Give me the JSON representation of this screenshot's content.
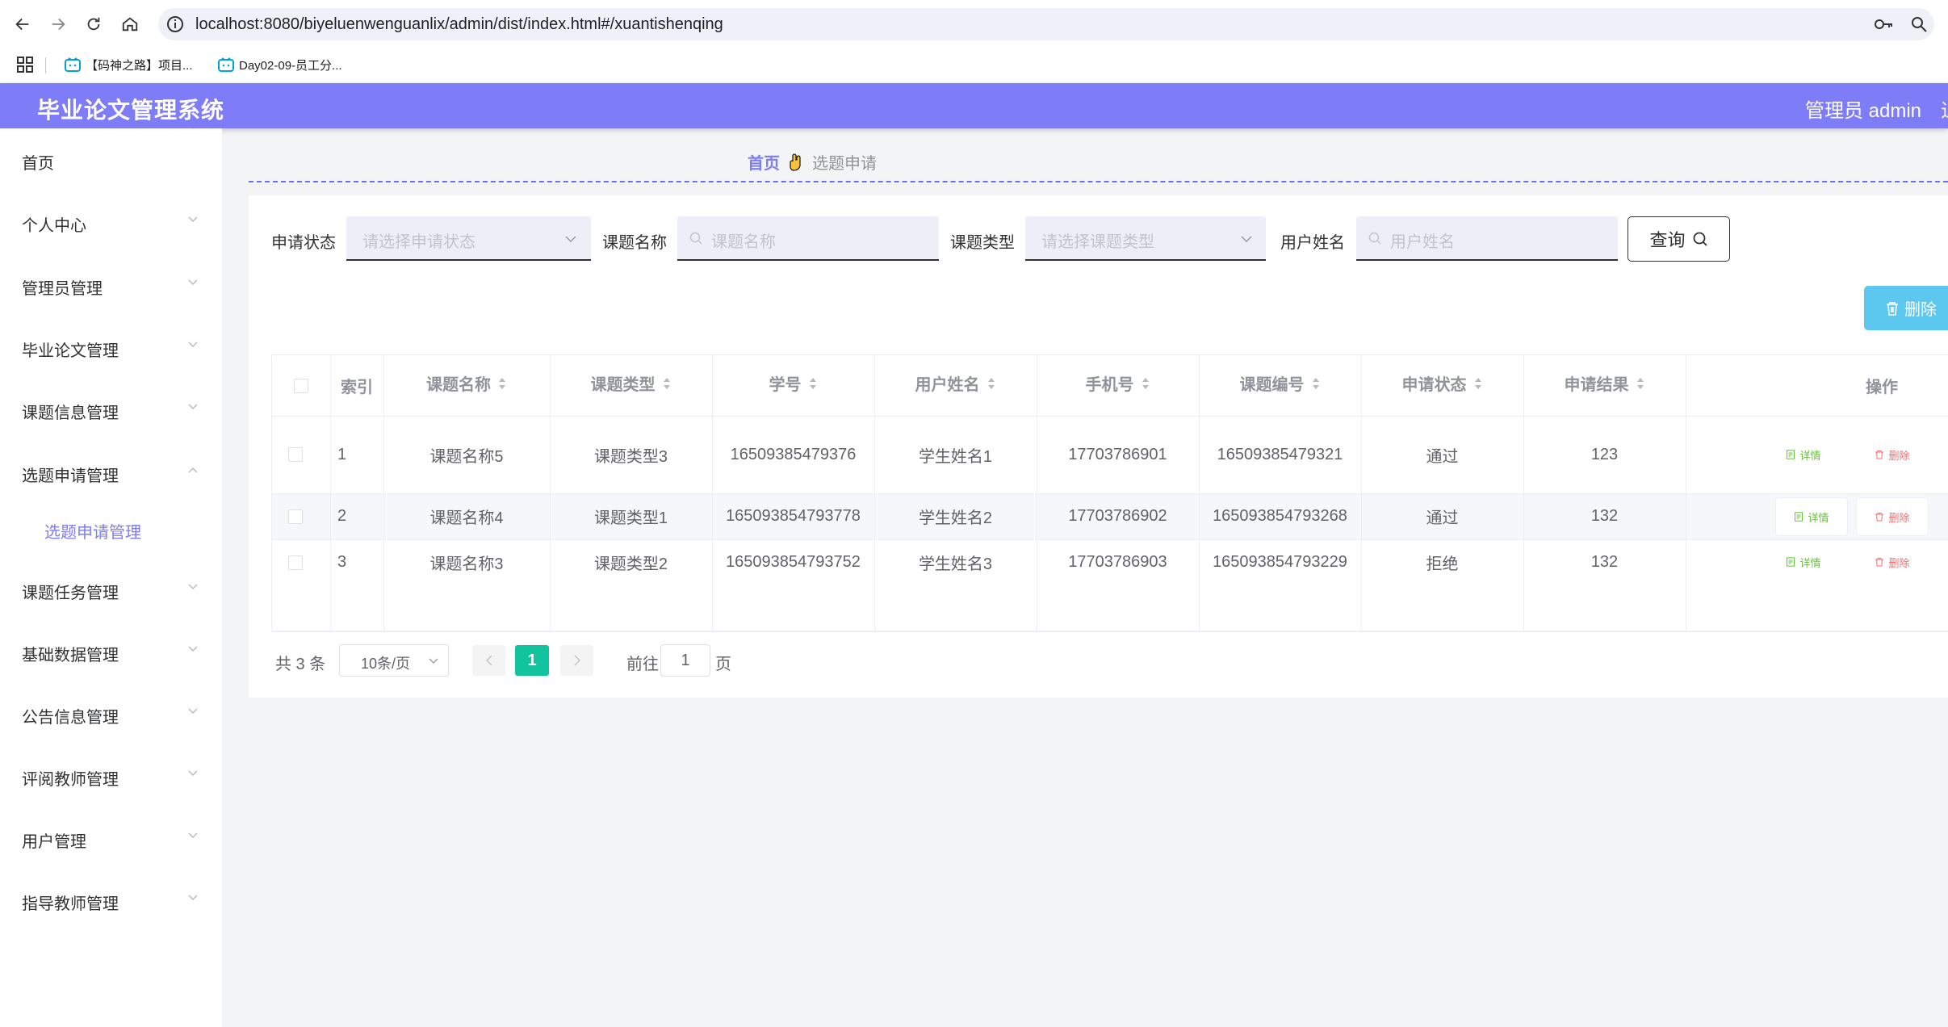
{
  "browser": {
    "url": "localhost:8080/biyeluenwenguanlix/admin/dist/index.html#/xuantishenqing",
    "bookmarks": [
      "【码神之路】项目...",
      "Day02-09-员工分..."
    ]
  },
  "header": {
    "title": "毕业论文管理系统",
    "admin": "管理员 admin",
    "extra": "退"
  },
  "sidebar": {
    "items": [
      {
        "label": "首页"
      },
      {
        "label": "个人中心"
      },
      {
        "label": "管理员管理"
      },
      {
        "label": "毕业论文管理"
      },
      {
        "label": "课题信息管理"
      },
      {
        "label": "选题申请管理"
      },
      {
        "label": "选题申请管理"
      },
      {
        "label": "课题任务管理"
      },
      {
        "label": "基础数据管理"
      },
      {
        "label": "公告信息管理"
      },
      {
        "label": "评阅教师管理"
      },
      {
        "label": "用户管理"
      },
      {
        "label": "指导教师管理"
      }
    ]
  },
  "breadcrumb": {
    "home": "首页",
    "current": "选题申请"
  },
  "search": {
    "status_label": "申请状态",
    "status_placeholder": "请选择申请状态",
    "title_label": "课题名称",
    "title_placeholder": "课题名称",
    "type_label": "课题类型",
    "type_placeholder": "请选择课题类型",
    "user_label": "用户姓名",
    "user_placeholder": "用户姓名",
    "query_button": "查询"
  },
  "toolbar": {
    "delete_label": "删除"
  },
  "table": {
    "headers": [
      "索引",
      "课题名称",
      "课题类型",
      "学号",
      "用户姓名",
      "手机号",
      "课题编号",
      "申请状态",
      "申请结果",
      "操作"
    ],
    "detail_label": "详情",
    "delete_label": "删除",
    "rows": [
      {
        "index": "1",
        "topic_name": "课题名称5",
        "topic_type": "课题类型3",
        "student_no": "16509385479376",
        "user_name": "学生姓名1",
        "phone": "17703786901",
        "topic_no": "16509385479321",
        "status": "通过",
        "result": "123"
      },
      {
        "index": "2",
        "topic_name": "课题名称4",
        "topic_type": "课题类型1",
        "student_no": "165093854793778",
        "user_name": "学生姓名2",
        "phone": "17703786902",
        "topic_no": "165093854793268",
        "status": "通过",
        "result": "132"
      },
      {
        "index": "3",
        "topic_name": "课题名称3",
        "topic_type": "课题类型2",
        "student_no": "165093854793752",
        "user_name": "学生姓名3",
        "phone": "17703786903",
        "topic_no": "165093854793229",
        "status": "拒绝",
        "result": "132"
      }
    ]
  },
  "pagination": {
    "total": "共 3 条",
    "page_size": "10条/页",
    "current_page": "1",
    "goto_label": "前往",
    "goto_value": "1",
    "page_unit": "页"
  },
  "colors": {
    "accent": "#7e7cf7",
    "delete_button": "#5cc7ef",
    "current_page": "#12c49d",
    "detail": "#67c23a",
    "danger": "#f56c6c"
  }
}
